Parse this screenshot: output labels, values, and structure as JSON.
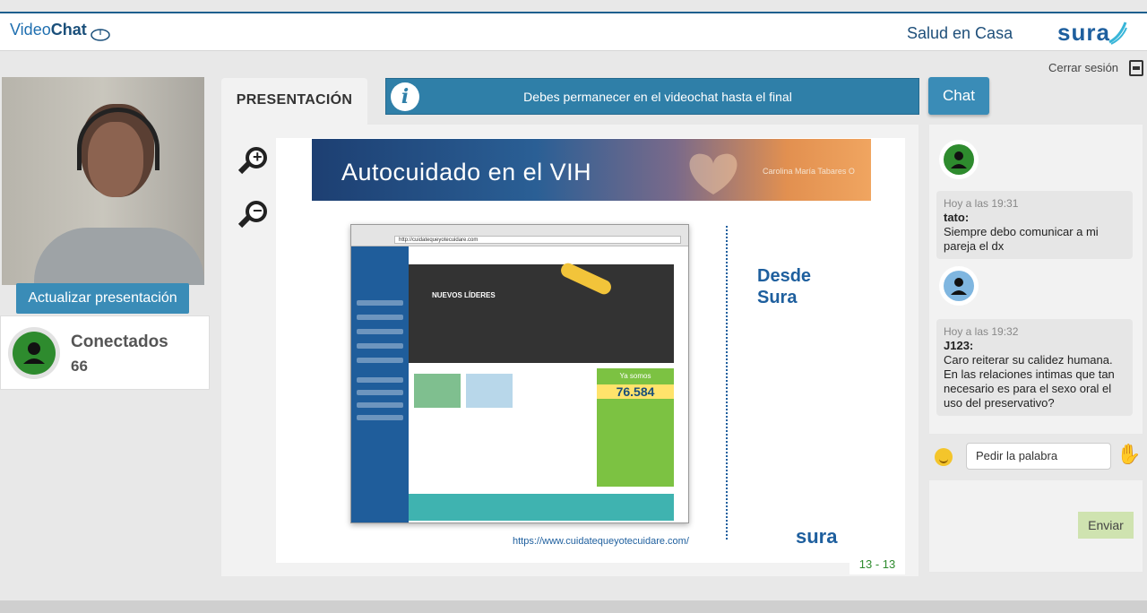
{
  "header": {
    "logo_video": "Video",
    "logo_chat": "Chat",
    "product": "Salud en Casa",
    "brand": "sura",
    "logout_label": "Cerrar sesión"
  },
  "left": {
    "update_button": "Actualizar presentación",
    "connected_label": "Conectados",
    "connected_count": "66"
  },
  "center": {
    "tab_label": "PRESENTACIÓN",
    "notice": "Debes permanecer en el videochat hasta el final",
    "slide": {
      "title": "Autocuidado en el VIH",
      "author": "Carolina María Tabares O",
      "browser_url": "http://cuidatequeyotecuidare.com",
      "hero_heading": "NUEVOS LÍDERES",
      "counter_label": "Ya somos",
      "counter_value": "76.584",
      "side_text_line1": "Desde",
      "side_text_line2": "Sura",
      "footer_url": "https://www.cuidatequeyotecuidare.com/",
      "footer_brand": "sura"
    },
    "page_indicator": "13 - 13"
  },
  "chat": {
    "tab_label": "Chat",
    "messages": [
      {
        "time": "Hoy a las 19:31",
        "user": "tato:",
        "text": "Siempre debo comunicar a mi pareja el dx",
        "avatar_color": "#2e8b2e"
      },
      {
        "time": "Hoy a las 19:32",
        "user": "J123:",
        "text": "Caro reiterar su calidez humana. En las relaciones intimas que tan necesario es para el sexo oral el uso del preservativo?",
        "avatar_color": "#7fb6e0"
      }
    ],
    "raise_hand_label": "Pedir la palabra",
    "send_label": "Enviar"
  },
  "colors": {
    "accent": "#3a8cb7",
    "brand_blue": "#1e5f9e",
    "online_green": "#2e8b2e"
  }
}
